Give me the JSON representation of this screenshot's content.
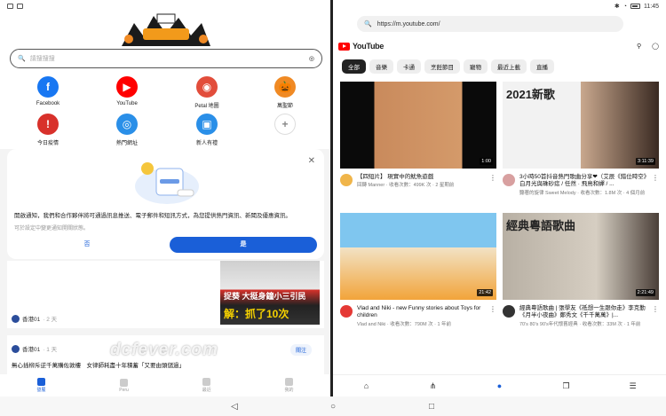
{
  "status": {
    "time": "11:45"
  },
  "left": {
    "search_placeholder": "請搜搜搜",
    "shortcuts": [
      {
        "label": "Facebook",
        "icon": "facebook-icon",
        "color": "#1877f2",
        "glyph": "f"
      },
      {
        "label": "YouTube",
        "icon": "youtube-icon",
        "color": "#ff0000",
        "glyph": "▶"
      },
      {
        "label": "Petal 地圖",
        "icon": "map-pin-icon",
        "color": "#e24d3b",
        "glyph": "◉"
      },
      {
        "label": "萬聖節",
        "icon": "halloween-icon",
        "color": "#f08a24",
        "glyph": "🎃"
      },
      {
        "label": "今日疫情",
        "icon": "alert-icon",
        "color": "#d8312b",
        "glyph": "!"
      },
      {
        "label": "熱門網址",
        "icon": "globe-icon",
        "color": "#2a8fe8",
        "glyph": "◎"
      },
      {
        "label": "新人有禮",
        "icon": "gift-icon",
        "color": "#2a8fe8",
        "glyph": "▣"
      },
      {
        "label": "",
        "icon": "add-icon",
        "color": "#ffffff",
        "glyph": "+"
      }
    ],
    "dialog": {
      "title": "開啟通知，我們和合作夥伴將可通過訊息推送、電子郵件和短訊方式，為您提供熱門資訊、新聞及優惠資訊。",
      "subtitle": "可於設定中變更通知開關狀態。",
      "no_label": "否",
      "yes_label": "是"
    },
    "news1": {
      "source": "香港01",
      "ago": "· 2 天",
      "thumb_line1": "捉葵  大挺身鐘小三引民",
      "thumb_line2": "解：抓了10次"
    },
    "news2": {
      "source": "香港01",
      "ago": "· 1 天",
      "follow_label": "關注",
      "headline": "無心插柳斥逆千萬購佐敦樓　女律師耗盡十年積蓄「又要由頭儲過」"
    },
    "nav": [
      {
        "label": "發展",
        "active": true
      },
      {
        "label": "Peru",
        "active": false
      },
      {
        "label": "最近",
        "active": false
      },
      {
        "label": "我的",
        "active": false
      }
    ]
  },
  "watermark": "dcfever.com",
  "right": {
    "url": "https://m.youtube.com/",
    "brand": "YouTube",
    "chips": [
      "全部",
      "音樂",
      "卡通",
      "烹飪節目",
      "寵物",
      "最近上載",
      "直播"
    ],
    "videos": [
      {
        "title": "【四短片】 現實中的魷魚遊戲",
        "sub": "回轉 Manner · 收看次數：499K 次 · 2 星期前",
        "duration": "1:00",
        "thumb": "squid",
        "avatar": "#f0b54a"
      },
      {
        "title": "3小時50首抖音熱門歌曲分享❤（艾辰《錯位時空》白月光與硃砂痣 / 任然 · 飛鳥和蟬 / ...",
        "sub": "聽著的旋律 Sweet Melody · 收看次數：1.8M 次 · 4 個月前",
        "duration": "3:11:39",
        "thumb": "song2021",
        "thumb_text": "2021新歌",
        "avatar": "#d8a0a0"
      },
      {
        "title": "Vlad and Niki - new Funny stories about Toys for children",
        "sub": "Vlad and Niki · 收看次數：790M 次 · 1 年前",
        "duration": "21:42",
        "thumb": "kids",
        "avatar": "#e53935"
      },
      {
        "title": "經典粵語歌曲 | 張學友《祗想一生跟你走》李克勤《月半小夜曲》鄭秀文《千千萬萬》|...",
        "sub": "70's 80's 90's年代懷舊經典 · 收看次數：33M 次 · 1 年前",
        "duration": "2:21:49",
        "thumb": "canto",
        "thumb_text": "經典粵語歌曲",
        "avatar": "#333"
      }
    ]
  }
}
